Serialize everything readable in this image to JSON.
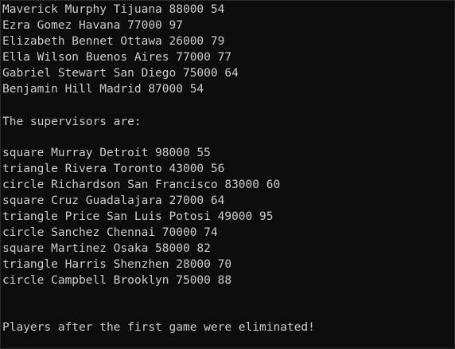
{
  "console": {
    "lines": [
      "Maverick Murphy Tijuana 88000 54",
      "Ezra Gomez Havana 77000 97",
      "Elizabeth Bennet Ottawa 26000 79",
      "Ella Wilson Buenos Aires 77000 77",
      "Gabriel Stewart San Diego 75000 64",
      "Benjamin Hill Madrid 87000 54",
      "",
      "The supervisors are:",
      "",
      "square Murray Detroit 98000 55",
      "triangle Rivera Toronto 43000 56",
      "circle Richardson San Francisco 83000 60",
      "square Cruz Guadalajara 27000 64",
      "triangle Price San Luis Potosi 49000 95",
      "circle Sanchez Chennai 70000 74",
      "square Martinez Osaka 58000 82",
      "triangle Harris Shenzhen 28000 70",
      "circle Campbell Brooklyn 75000 88",
      "",
      "",
      "Players after the first game were eliminated!"
    ]
  },
  "colors": {
    "background": "#0c0c0c",
    "text": "#cccccc"
  }
}
